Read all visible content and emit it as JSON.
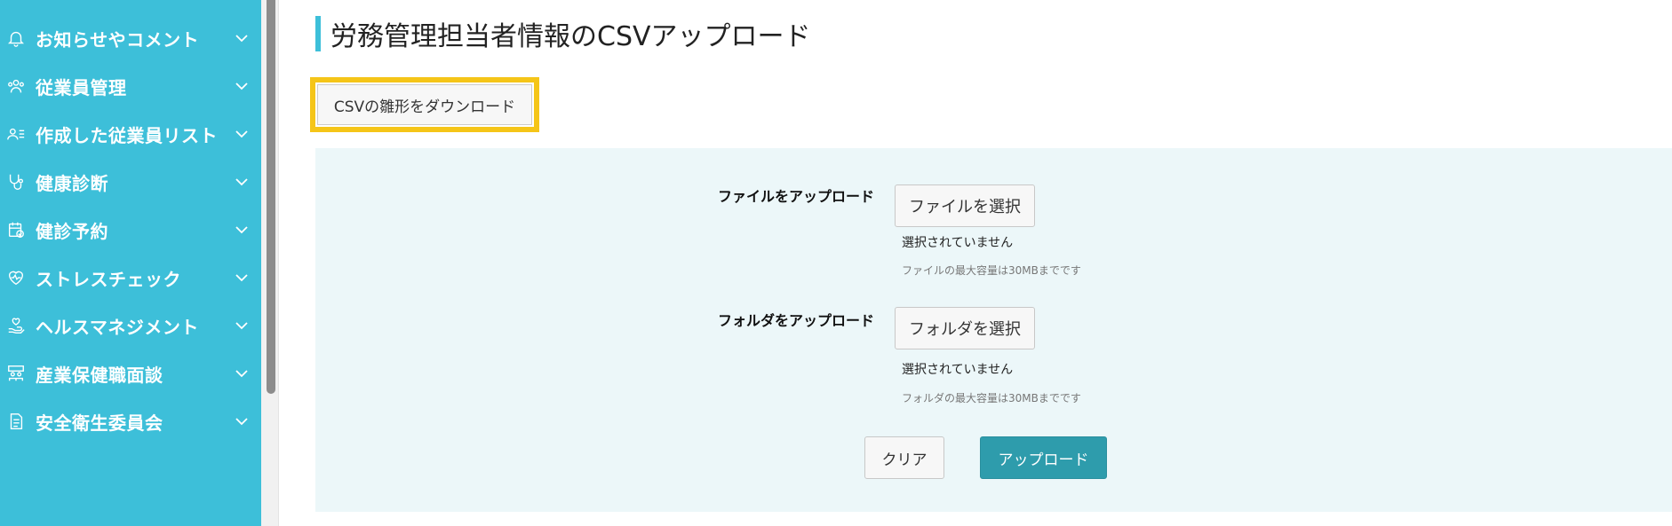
{
  "sidebar": {
    "items": [
      {
        "label": "お知らせやコメント",
        "icon": "bell-icon"
      },
      {
        "label": "従業員管理",
        "icon": "users-icon"
      },
      {
        "label": "作成した従業員リスト",
        "icon": "user-list-icon"
      },
      {
        "label": "健康診断",
        "icon": "stethoscope-icon"
      },
      {
        "label": "健診予約",
        "icon": "calendar-check-icon"
      },
      {
        "label": "ストレスチェック",
        "icon": "heart-icon"
      },
      {
        "label": "ヘルスマネジメント",
        "icon": "hand-heart-icon"
      },
      {
        "label": "産業保健職面談",
        "icon": "meeting-icon"
      },
      {
        "label": "安全衛生委員会",
        "icon": "document-icon"
      }
    ]
  },
  "main": {
    "title": "労務管理担当者情報のCSVアップロード",
    "template_download_label": "CSVの雛形をダウンロード",
    "file_upload": {
      "label": "ファイルをアップロード",
      "button": "ファイルを選択",
      "status": "選択されていません",
      "hint": "ファイルの最大容量は30MBまでです"
    },
    "folder_upload": {
      "label": "フォルダをアップロード",
      "button": "フォルダを選択",
      "status": "選択されていません",
      "hint": "フォルダの最大容量は30MBまでです"
    },
    "clear_label": "クリア",
    "upload_label": "アップロード"
  },
  "colors": {
    "sidebar_bg": "#3dbfd9",
    "highlight": "#f5c518",
    "panel_bg": "#ecf7f9",
    "primary_button": "#2e9cac"
  }
}
